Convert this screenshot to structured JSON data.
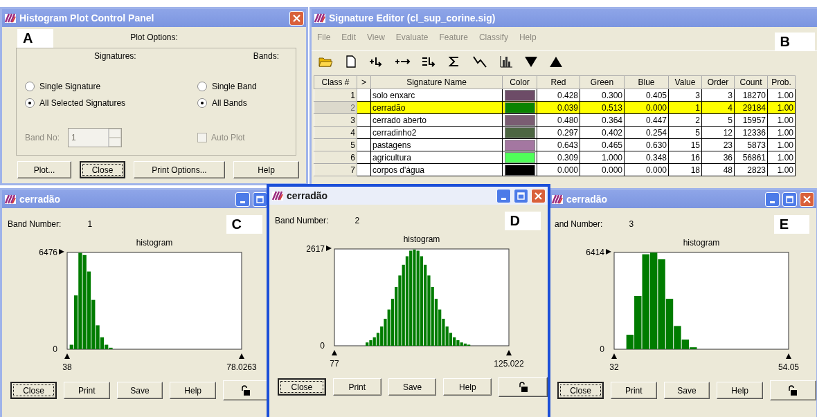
{
  "control_panel": {
    "title": "Histogram Plot Control Panel",
    "active": false,
    "title_buttons": [
      {
        "kind": "close"
      }
    ],
    "panel_label": "A",
    "plot_options": "Plot Options:",
    "signatures": {
      "label": "Signatures:",
      "options": [
        {
          "label": "Single Signature",
          "selected": false
        },
        {
          "label": "All Selected Signatures",
          "selected": true
        }
      ]
    },
    "bands": {
      "label": "Bands:",
      "options": [
        {
          "label": "Single Band",
          "selected": false
        },
        {
          "label": "All Bands",
          "selected": true
        }
      ]
    },
    "band_no": {
      "label": "Band No:",
      "value": "1",
      "disabled": true
    },
    "auto_plot": {
      "label": "Auto Plot",
      "checked": false,
      "disabled": true
    },
    "buttons": [
      {
        "label": "Plot...",
        "default": false
      },
      {
        "label": "Close",
        "default": true
      },
      {
        "label": "Print Options...",
        "default": false
      },
      {
        "label": "Help",
        "default": false
      }
    ]
  },
  "signature_editor": {
    "title": "Signature Editor (cl_sup_corine.sig)",
    "active": false,
    "panel_label": "B",
    "menu": [
      {
        "label": "File",
        "disabled": true
      },
      {
        "label": "Edit",
        "disabled": true
      },
      {
        "label": "View",
        "disabled": true
      },
      {
        "label": "Evaluate",
        "disabled": true
      },
      {
        "label": "Feature",
        "disabled": true
      },
      {
        "label": "Classify",
        "disabled": true
      },
      {
        "label": "Help",
        "disabled": true
      }
    ],
    "toolbar": [
      {
        "kind": "open"
      },
      {
        "kind": "new"
      },
      {
        "kind": "add"
      },
      {
        "kind": "replace"
      },
      {
        "kind": "merge"
      },
      {
        "kind": "sum"
      },
      {
        "kind": "plot"
      },
      {
        "kind": "histogram"
      },
      {
        "kind": "down"
      },
      {
        "kind": "up"
      }
    ],
    "table": {
      "columns": [
        "Class #",
        ">",
        "Signature Name",
        "Color",
        "Red",
        "Green",
        "Blue",
        "Value",
        "Order",
        "Count",
        "Prob."
      ],
      "rows": [
        {
          "class": "1",
          "name": "solo enxarc",
          "color": "#6d4c67",
          "red": "0.428",
          "green": "0.300",
          "blue": "0.405",
          "value": "3",
          "order": "3",
          "count": "18270",
          "prob": "1.00",
          "selected": false
        },
        {
          "class": "2",
          "name": "cerradão",
          "color": "#0a8300",
          "red": "0.039",
          "green": "0.513",
          "blue": "0.000",
          "value": "1",
          "order": "4",
          "count": "29184",
          "prob": "1.00",
          "selected": true
        },
        {
          "class": "3",
          "name": "cerrado aberto",
          "color": "#7a5d72",
          "red": "0.480",
          "green": "0.364",
          "blue": "0.447",
          "value": "2",
          "order": "5",
          "count": "15957",
          "prob": "1.00",
          "selected": false
        },
        {
          "class": "4",
          "name": "cerradinho2",
          "color": "#4c6641",
          "red": "0.297",
          "green": "0.402",
          "blue": "0.254",
          "value": "5",
          "order": "12",
          "count": "12336",
          "prob": "1.00",
          "selected": false
        },
        {
          "class": "5",
          "name": "pastagens",
          "color": "#a477a1",
          "red": "0.643",
          "green": "0.465",
          "blue": "0.630",
          "value": "15",
          "order": "23",
          "count": "5873",
          "prob": "1.00",
          "selected": false
        },
        {
          "class": "6",
          "name": "agricultura",
          "color": "#4fff59",
          "red": "0.309",
          "green": "1.000",
          "blue": "0.348",
          "value": "16",
          "order": "36",
          "count": "56861",
          "prob": "1.00",
          "selected": false
        },
        {
          "class": "7",
          "name": "corpos d'água",
          "color": "#000000",
          "red": "0.000",
          "green": "0.000",
          "blue": "0.000",
          "value": "18",
          "order": "48",
          "count": "2823",
          "prob": "1.00",
          "selected": false
        }
      ]
    }
  },
  "histograms": [
    {
      "title": "cerradão",
      "active": false,
      "title_buttons": [
        {
          "kind": "minimize"
        },
        {
          "kind": "maximize"
        }
      ],
      "panel_label": "C",
      "band_label": "Band Number:",
      "band_number": "1",
      "chart_data": {
        "type": "bar",
        "title": "histogram",
        "x": [
          39,
          40,
          41,
          42,
          43,
          44,
          45,
          46,
          47,
          48
        ],
        "values": [
          300,
          3600,
          6450,
          6300,
          5200,
          3300,
          1600,
          800,
          300,
          100
        ],
        "xlim": [
          38,
          78.0263
        ],
        "ylim": [
          0,
          6476
        ],
        "xticks": [
          {
            "value": 38,
            "label": "38"
          },
          {
            "value": 78.0263,
            "label": "78.0263"
          }
        ],
        "yticks": [
          0,
          6476
        ]
      },
      "buttons": [
        {
          "label": "Close",
          "default": true
        },
        {
          "label": "Print",
          "default": false
        },
        {
          "label": "Save",
          "default": false
        },
        {
          "label": "Help",
          "default": false
        }
      ]
    },
    {
      "title": "cerradão",
      "active": true,
      "title_buttons": [
        {
          "kind": "minimize"
        },
        {
          "kind": "maximize"
        },
        {
          "kind": "close"
        }
      ],
      "panel_label": "D",
      "band_label": "Band Number:",
      "band_number": "2",
      "chart_data": {
        "type": "bar",
        "title": "histogram",
        "x": [
          86,
          87,
          88,
          89,
          90,
          91,
          92,
          93,
          94,
          95,
          96,
          97,
          98,
          99,
          100,
          101,
          102,
          103,
          104,
          105,
          106,
          107,
          108,
          109,
          110,
          111,
          112,
          113,
          114
        ],
        "values": [
          90,
          150,
          230,
          350,
          520,
          730,
          980,
          1270,
          1590,
          1900,
          2190,
          2420,
          2570,
          2600,
          2570,
          2420,
          2190,
          1900,
          1590,
          1270,
          980,
          730,
          520,
          350,
          230,
          150,
          90,
          60,
          30
        ],
        "xlim": [
          77,
          125.022
        ],
        "ylim": [
          0,
          2617
        ],
        "xticks": [
          {
            "value": 77,
            "label": "77"
          },
          {
            "value": 125.022,
            "label": "125.022"
          }
        ],
        "yticks": [
          0,
          2617
        ]
      },
      "buttons": [
        {
          "label": "Close",
          "default": true
        },
        {
          "label": "Print",
          "default": false
        },
        {
          "label": "Save",
          "default": false
        },
        {
          "label": "Help",
          "default": false
        }
      ]
    },
    {
      "title": "cerradão",
      "active": false,
      "title_buttons": [
        {
          "kind": "minimize"
        },
        {
          "kind": "maximize"
        },
        {
          "kind": "close"
        }
      ],
      "panel_label": "E",
      "band_label": "and Number:",
      "band_number": "3",
      "chart_data": {
        "type": "bar",
        "title": "histogram",
        "x": [
          34,
          35,
          36,
          37,
          38,
          39,
          40,
          41,
          42
        ],
        "values": [
          960,
          3530,
          6290,
          6400,
          5960,
          3340,
          1540,
          640,
          130
        ],
        "xlim": [
          32,
          54.05
        ],
        "ylim": [
          0,
          6414
        ],
        "xticks": [
          {
            "value": 32,
            "label": "32"
          },
          {
            "value": 54.05,
            "label": "54.05"
          }
        ],
        "yticks": [
          0,
          6414
        ]
      },
      "buttons": [
        {
          "label": "Close",
          "default": true
        },
        {
          "label": "Print",
          "default": false
        },
        {
          "label": "Save",
          "default": false
        },
        {
          "label": "Help",
          "default": false
        }
      ]
    }
  ]
}
